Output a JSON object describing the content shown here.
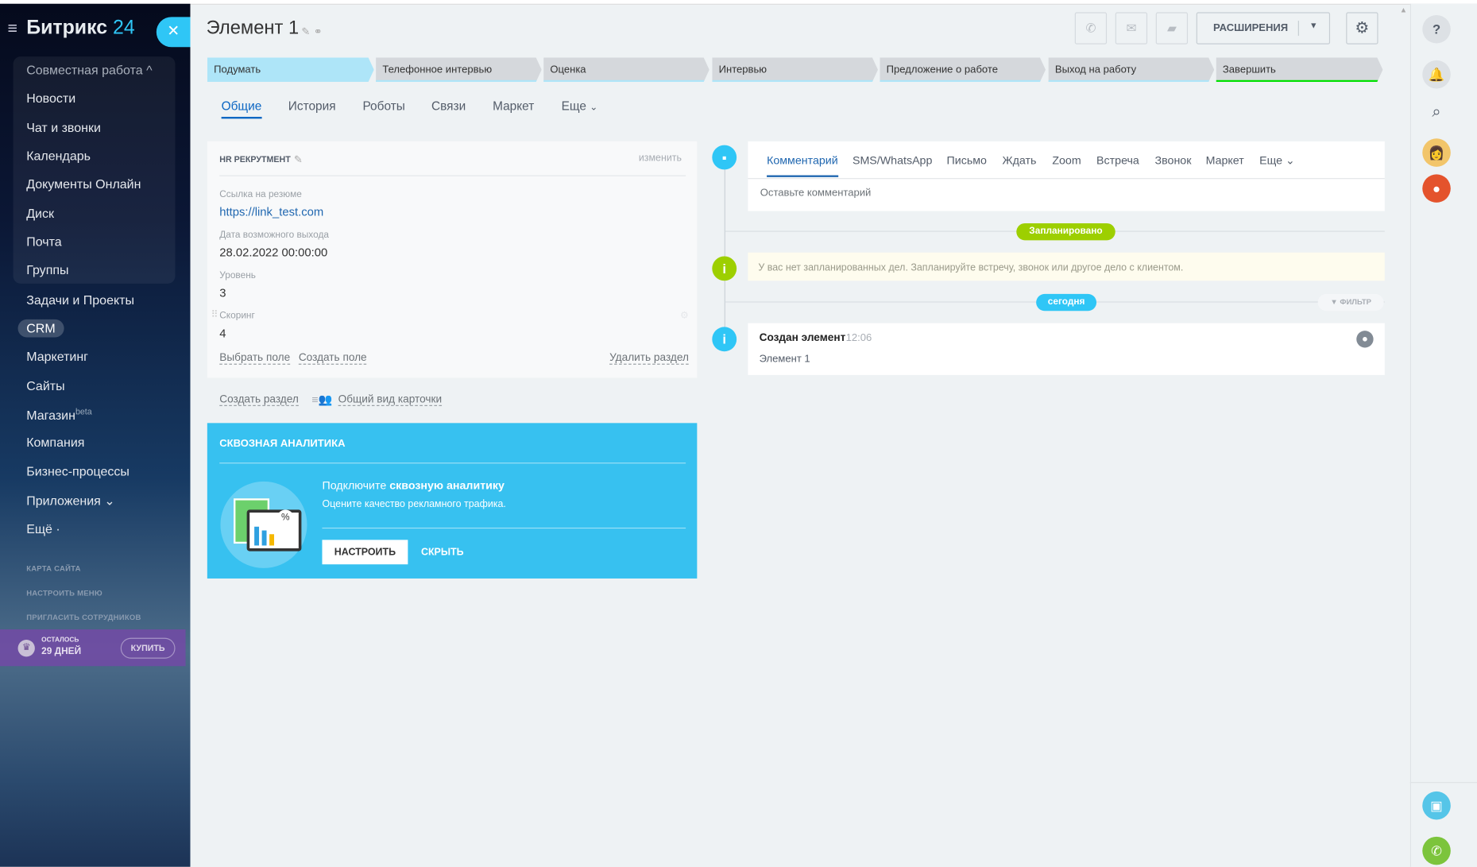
{
  "sidebar": {
    "logo_text": "Битрикс",
    "logo_num": "24",
    "group_title": "Совместная работа ^",
    "group_items": [
      "Новости",
      "Чат и звонки",
      "Календарь",
      "Документы Онлайн",
      "Диск",
      "Почта",
      "Группы"
    ],
    "items": [
      "Задачи и Проекты",
      "CRM",
      "Маркетинг",
      "Сайты",
      "Магазин",
      "Компания",
      "Бизнес-процессы",
      "Приложения ⌄",
      "Ещё ·"
    ],
    "beta": "beta",
    "links": [
      "КАРТА САЙТА",
      "НАСТРОИТЬ МЕНЮ",
      "ПРИГЛАСИТЬ СОТРУДНИКОВ"
    ],
    "trial": {
      "line1": "ОСТАЛОСЬ",
      "line2": "29 ДНЕЙ",
      "buy": "КУПИТЬ"
    }
  },
  "header": {
    "title": "Элемент 1",
    "extensions": "РАСШИРЕНИЯ"
  },
  "stages": [
    "Подумать",
    "Телефонное интервью",
    "Оценка",
    "Интервью",
    "Предложение о работе",
    "Выход на работу",
    "Завершить"
  ],
  "tabs": [
    "Общие",
    "История",
    "Роботы",
    "Связи",
    "Маркет",
    "Еще"
  ],
  "card": {
    "title": "HR РЕКРУТМЕНТ",
    "edit": "изменить",
    "fields": [
      {
        "label": "Ссылка на резюме",
        "value": "https://link_test.com"
      },
      {
        "label": "Дата возможного выхода",
        "value": "28.02.2022 00:00:00"
      },
      {
        "label": "Уровень",
        "value": "3"
      },
      {
        "label": "Скоринг",
        "value": "4"
      }
    ],
    "select_field": "Выбрать поле",
    "create_field": "Создать поле",
    "delete_section": "Удалить раздел"
  },
  "below": {
    "create_section": "Создать раздел",
    "common_view": "Общий вид карточки"
  },
  "analytics": {
    "title": "СКВОЗНАЯ АНАЛИТИКА",
    "text_pre": "Подключите ",
    "text_bold": "сквозную аналитику",
    "sub": "Оцените качество рекламного трафика.",
    "setup": "НАСТРОИТЬ",
    "hide": "СКРЫТЬ"
  },
  "timeline": {
    "tabs": [
      "Комментарий",
      "SMS/WhatsApp",
      "Письмо",
      "Ждать",
      "Zoom",
      "Встреча",
      "Звонок",
      "Маркет",
      "Еще"
    ],
    "comment_placeholder": "Оставьте комментарий",
    "planned": "Запланировано",
    "empty": "У вас нет запланированных дел. Запланируйте встречу, звонок или другое дело с клиентом.",
    "today": "сегодня",
    "filter": "ФИЛЬТР",
    "event_title": "Создан элемент",
    "event_time": "12:06",
    "event_body": "Элемент 1"
  }
}
